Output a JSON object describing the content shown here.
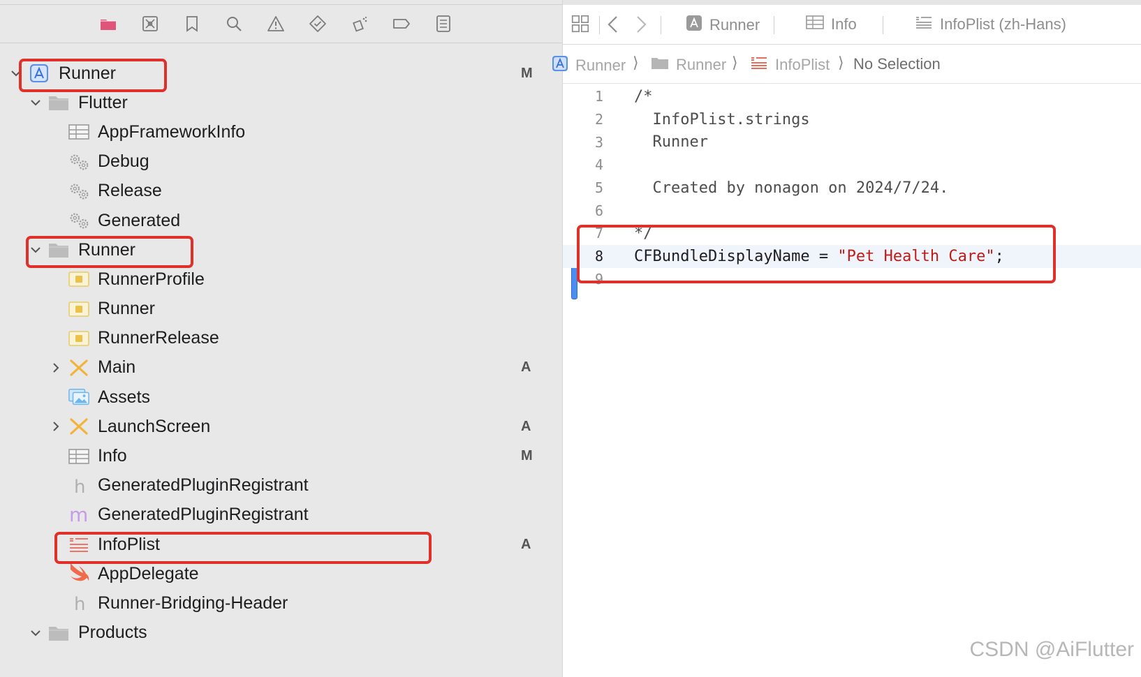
{
  "navigator": {
    "toolbar_icons": [
      "folder-icon",
      "source-control-icon",
      "bookmark-icon",
      "search-icon",
      "warning-icon",
      "test-diamond-icon",
      "debug-icon",
      "breakpoint-icon",
      "report-icon"
    ],
    "tree": [
      {
        "label": "Runner",
        "icon": "xcode-project-icon",
        "depth": 0,
        "expanded": true,
        "status": "M"
      },
      {
        "label": "Flutter",
        "icon": "folder-icon",
        "depth": 1,
        "expanded": true,
        "status": ""
      },
      {
        "label": "AppFrameworkInfo",
        "icon": "plist-icon",
        "depth": 2,
        "status": ""
      },
      {
        "label": "Debug",
        "icon": "xcconfig-icon",
        "depth": 2,
        "status": ""
      },
      {
        "label": "Release",
        "icon": "xcconfig-icon",
        "depth": 2,
        "status": ""
      },
      {
        "label": "Generated",
        "icon": "xcconfig-icon",
        "depth": 2,
        "status": ""
      },
      {
        "label": "Runner",
        "icon": "folder-icon",
        "depth": 1,
        "expanded": true,
        "status": ""
      },
      {
        "label": "RunnerProfile",
        "icon": "entitlements-icon",
        "depth": 2,
        "status": ""
      },
      {
        "label": "Runner",
        "icon": "entitlements-icon",
        "depth": 2,
        "status": ""
      },
      {
        "label": "RunnerRelease",
        "icon": "entitlements-icon",
        "depth": 2,
        "status": ""
      },
      {
        "label": "Main",
        "icon": "storyboard-icon",
        "depth": 2,
        "collapsed": true,
        "status": "A"
      },
      {
        "label": "Assets",
        "icon": "asset-catalog-icon",
        "depth": 2,
        "status": ""
      },
      {
        "label": "LaunchScreen",
        "icon": "storyboard-icon",
        "depth": 2,
        "collapsed": true,
        "status": "A"
      },
      {
        "label": "Info",
        "icon": "plist-icon",
        "depth": 2,
        "status": "M"
      },
      {
        "label": "GeneratedPluginRegistrant",
        "icon": "header-file-icon",
        "depth": 2,
        "status": ""
      },
      {
        "label": "GeneratedPluginRegistrant",
        "icon": "objc-file-icon",
        "depth": 2,
        "status": ""
      },
      {
        "label": "InfoPlist",
        "icon": "strings-file-icon",
        "depth": 2,
        "status": "A"
      },
      {
        "label": "AppDelegate",
        "icon": "swift-file-icon",
        "depth": 2,
        "status": ""
      },
      {
        "label": "Runner-Bridging-Header",
        "icon": "header-file-icon",
        "depth": 2,
        "status": ""
      },
      {
        "label": "Products",
        "icon": "folder-icon",
        "depth": 1,
        "expanded": true,
        "status": ""
      }
    ]
  },
  "editor": {
    "tabs": [
      {
        "label": "Runner",
        "icon": "xcode-project-icon"
      },
      {
        "label": "Info",
        "icon": "plist-icon"
      },
      {
        "label": "InfoPlist (zh-Hans)",
        "icon": "strings-file-icon"
      }
    ],
    "jumpbar": [
      {
        "label": "Runner",
        "icon": "xcode-project-icon"
      },
      {
        "label": "Runner",
        "icon": "folder-icon"
      },
      {
        "label": "InfoPlist",
        "icon": "strings-file-icon"
      },
      {
        "label": "No Selection",
        "icon": ""
      }
    ],
    "lines": [
      {
        "n": "1",
        "text": "/*"
      },
      {
        "n": "2",
        "text": "  InfoPlist.strings"
      },
      {
        "n": "3",
        "text": "  Runner"
      },
      {
        "n": "4",
        "text": ""
      },
      {
        "n": "5",
        "text": "  Created by nonagon on 2024/7/24."
      },
      {
        "n": "6",
        "text": ""
      },
      {
        "n": "7",
        "text": "*/"
      },
      {
        "n": "8",
        "key": "CFBundleDisplayName = ",
        "value": "\"Pet Health Care\"",
        "end": ";"
      },
      {
        "n": "9",
        "text": ""
      }
    ],
    "current_line": "8"
  },
  "watermark": "CSDN @AiFlutter",
  "colors": {
    "highlight_box": "#e0302a",
    "string_literal": "#c41a16",
    "change_bar": "#4b8ef0",
    "sidebar_bg": "#e8e8e8"
  }
}
